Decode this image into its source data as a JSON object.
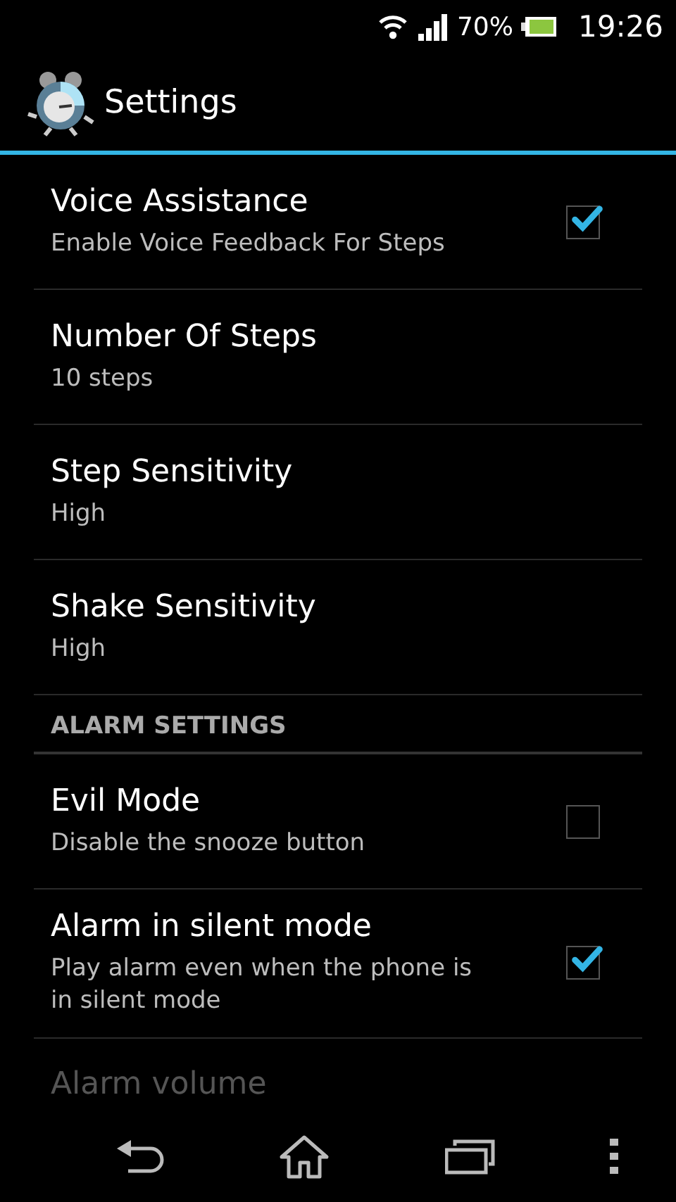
{
  "status_bar": {
    "battery": "70%",
    "time": "19:26"
  },
  "action_bar": {
    "title": "Settings"
  },
  "groups": [
    {
      "items": [
        {
          "kind": "checkbox",
          "title": "Voice Assistance",
          "summary": "Enable Voice Feedback For Steps",
          "checked": true
        },
        {
          "kind": "plain",
          "title": "Number Of Steps",
          "summary": "10 steps"
        },
        {
          "kind": "plain",
          "title": "Step Sensitivity",
          "summary": "High"
        },
        {
          "kind": "plain",
          "title": "Shake Sensitivity",
          "summary": "High"
        }
      ]
    },
    {
      "header": "ALARM SETTINGS",
      "items": [
        {
          "kind": "checkbox",
          "title": "Evil Mode",
          "summary": "Disable the snooze button",
          "checked": false
        },
        {
          "kind": "checkbox",
          "title": "Alarm in silent mode",
          "summary": "Play alarm even when the phone is in silent mode",
          "checked": true
        },
        {
          "kind": "partial",
          "title": "Alarm volume"
        }
      ]
    }
  ]
}
